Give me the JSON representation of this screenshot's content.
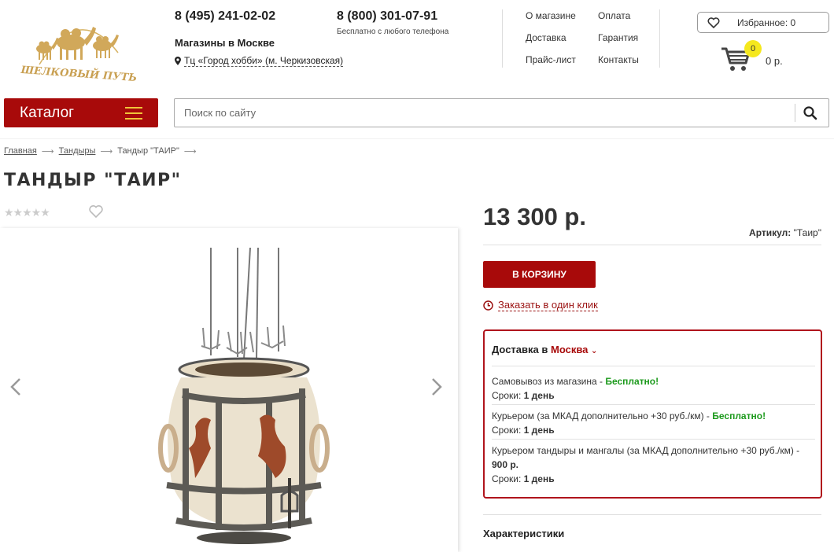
{
  "header": {
    "logo_text": "ШЕЛКОВЫЙ ПУТЬ",
    "phone_main": "8 (495) 241-02-02",
    "stores_label": "Магазины в Москве",
    "store_address": "Тц «Город хобби» (м. Черкизовская)",
    "phone_free": "8 (800) 301-07-91",
    "phone_free_note": "Бесплатно с любого телефона",
    "nav": [
      "О магазине",
      "Оплата",
      "Доставка",
      "Гарантия",
      "Прайс-лист",
      "Контакты"
    ],
    "favorites_label": "Избранное: 0",
    "cart_count": "0",
    "cart_sum": "0 р."
  },
  "catalog": {
    "label": "Каталог"
  },
  "search": {
    "placeholder": "Поиск по сайту"
  },
  "breadcrumb": [
    "Главная",
    "Тандыры",
    "Тандыр \"ТАИР\""
  ],
  "product": {
    "title": "ТАНДЫР \"ТАИР\"",
    "rating": 0,
    "price": "13 300 р.",
    "sku_label": "Артикул:",
    "sku_value": "\"Таир\"",
    "buy_label": "В КОРЗИНУ",
    "oneclick_label": "Заказать в один клик",
    "characteristics_label": "Характеристики"
  },
  "delivery": {
    "heading_prefix": "Доставка в",
    "city": "Москва",
    "rows": [
      {
        "text": "Самовывоз из магазина - ",
        "price": "Бесплатно!",
        "term_label": "Сроки: ",
        "term": "1 день"
      },
      {
        "text": "Курьером (за МКАД дополнительно +30 руб./км) - ",
        "price": "Бесплатно!",
        "term_label": "Сроки: ",
        "term": "1 день"
      },
      {
        "text": "Курьером тандыры и мангалы (за МКАД дополнительно +30 руб./км) - ",
        "price": "900 р.",
        "term_label": "Сроки: ",
        "term": "1 день"
      }
    ]
  },
  "colors": {
    "accent": "#a80a0a",
    "free": "#1c9a1c",
    "badge": "#f5e81e"
  }
}
